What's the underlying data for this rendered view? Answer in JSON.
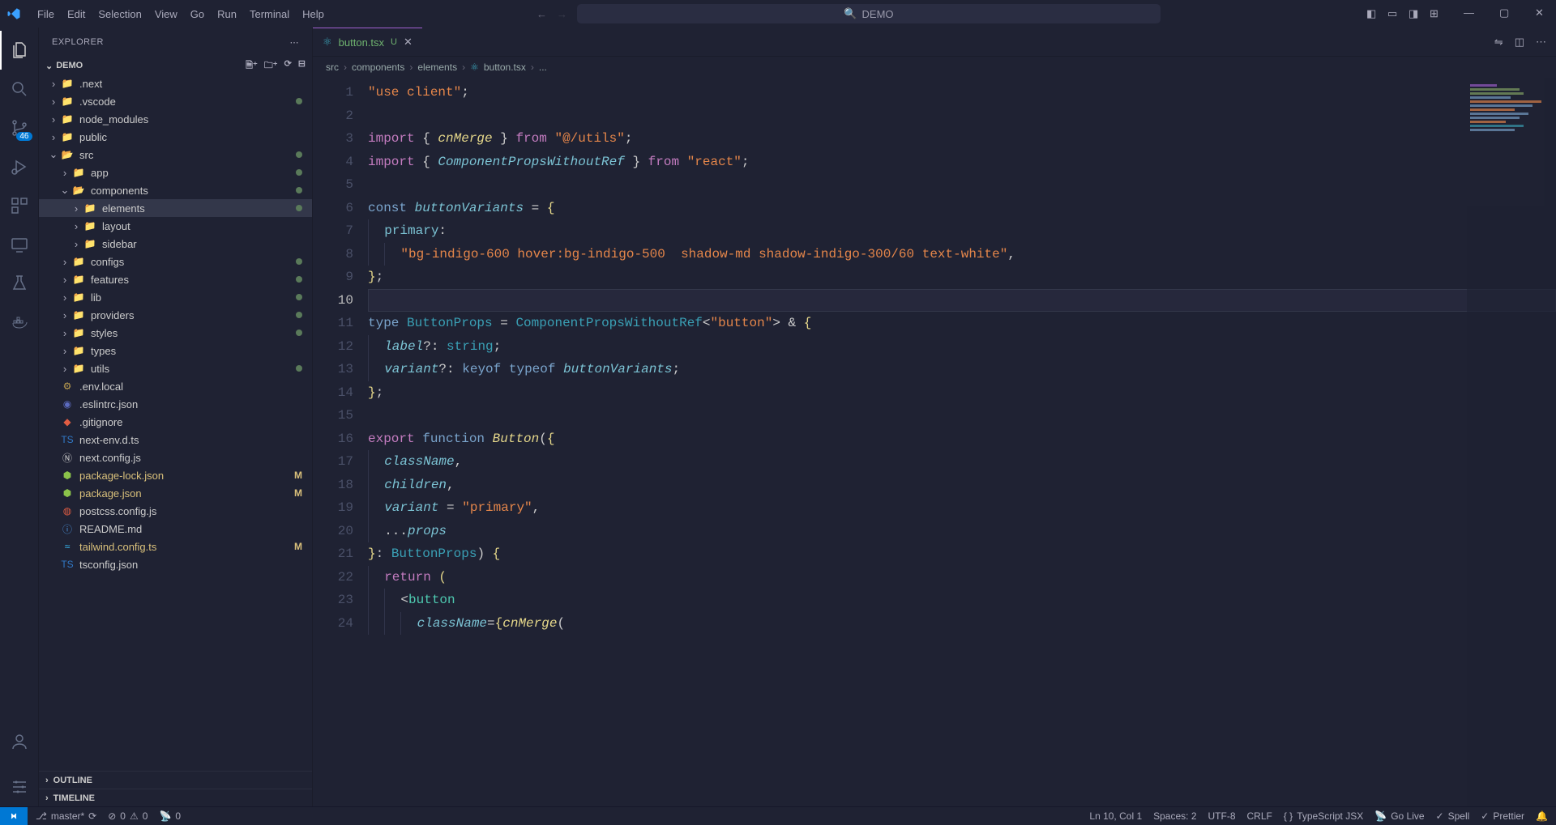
{
  "menu": {
    "items": [
      "File",
      "Edit",
      "Selection",
      "View",
      "Go",
      "Run",
      "Terminal",
      "Help"
    ]
  },
  "search": {
    "placeholder": "DEMO"
  },
  "explorer": {
    "title": "EXPLORER",
    "project": "DEMO"
  },
  "badges": {
    "scm": "46"
  },
  "tree": [
    {
      "depth": 0,
      "kind": "folder",
      "name": ".next",
      "chev": "›",
      "color": "#888",
      "icon": "📁",
      "status": ""
    },
    {
      "depth": 0,
      "kind": "folder",
      "name": ".vscode",
      "chev": "›",
      "color": "#4a90d9",
      "icon": "📁",
      "status": "dot"
    },
    {
      "depth": 0,
      "kind": "folder",
      "name": "node_modules",
      "chev": "›",
      "color": "#8bc34a",
      "icon": "📁",
      "status": ""
    },
    {
      "depth": 0,
      "kind": "folder",
      "name": "public",
      "chev": "›",
      "color": "#4a90d9",
      "icon": "📁",
      "status": ""
    },
    {
      "depth": 0,
      "kind": "folder",
      "name": "src",
      "chev": "⌄",
      "color": "#8bc34a",
      "icon": "📂",
      "status": "dot"
    },
    {
      "depth": 1,
      "kind": "folder",
      "name": "app",
      "chev": "›",
      "color": "#e57373",
      "icon": "📁",
      "status": "dot"
    },
    {
      "depth": 1,
      "kind": "folder",
      "name": "components",
      "chev": "⌄",
      "color": "#c0a050",
      "icon": "📂",
      "status": "dot"
    },
    {
      "depth": 2,
      "kind": "folder",
      "name": "elements",
      "chev": "›",
      "color": "#aaa",
      "icon": "📁",
      "status": "dot",
      "selected": true
    },
    {
      "depth": 2,
      "kind": "folder",
      "name": "layout",
      "chev": "›",
      "color": "#aaa",
      "icon": "📁",
      "status": ""
    },
    {
      "depth": 2,
      "kind": "folder",
      "name": "sidebar",
      "chev": "›",
      "color": "#aaa",
      "icon": "📁",
      "status": ""
    },
    {
      "depth": 1,
      "kind": "folder",
      "name": "configs",
      "chev": "›",
      "color": "#c0a050",
      "icon": "📁",
      "status": "dot"
    },
    {
      "depth": 1,
      "kind": "folder",
      "name": "features",
      "chev": "›",
      "color": "#c0a050",
      "icon": "📁",
      "status": "dot"
    },
    {
      "depth": 1,
      "kind": "folder",
      "name": "lib",
      "chev": "›",
      "color": "#c0a050",
      "icon": "📁",
      "status": "dot"
    },
    {
      "depth": 1,
      "kind": "folder",
      "name": "providers",
      "chev": "›",
      "color": "#c0a050",
      "icon": "📁",
      "status": "dot"
    },
    {
      "depth": 1,
      "kind": "folder",
      "name": "styles",
      "chev": "›",
      "color": "#c0a050",
      "icon": "📁",
      "status": "dot"
    },
    {
      "depth": 1,
      "kind": "folder",
      "name": "types",
      "chev": "›",
      "color": "#3a91c0",
      "icon": "📁",
      "status": ""
    },
    {
      "depth": 1,
      "kind": "folder",
      "name": "utils",
      "chev": "›",
      "color": "#c0a050",
      "icon": "📁",
      "status": "dot"
    },
    {
      "depth": 0,
      "kind": "file",
      "name": ".env.local",
      "icon": "⚙",
      "color": "#c0a050"
    },
    {
      "depth": 0,
      "kind": "file",
      "name": ".eslintrc.json",
      "icon": "◉",
      "color": "#5c6bc0"
    },
    {
      "depth": 0,
      "kind": "file",
      "name": ".gitignore",
      "icon": "◆",
      "color": "#e25d43"
    },
    {
      "depth": 0,
      "kind": "file",
      "name": "next-env.d.ts",
      "icon": "TS",
      "color": "#3178c6"
    },
    {
      "depth": 0,
      "kind": "file",
      "name": "next.config.js",
      "icon": "Ⓝ",
      "color": "#ccc"
    },
    {
      "depth": 0,
      "kind": "file",
      "name": "package-lock.json",
      "icon": "⬢",
      "color": "#8bc34a",
      "git": "M"
    },
    {
      "depth": 0,
      "kind": "file",
      "name": "package.json",
      "icon": "⬢",
      "color": "#8bc34a",
      "git": "M"
    },
    {
      "depth": 0,
      "kind": "file",
      "name": "postcss.config.js",
      "icon": "◍",
      "color": "#e25d43"
    },
    {
      "depth": 0,
      "kind": "file",
      "name": "README.md",
      "icon": "ⓘ",
      "color": "#4a90d9"
    },
    {
      "depth": 0,
      "kind": "file",
      "name": "tailwind.config.ts",
      "icon": "≈",
      "color": "#38bdf8",
      "git": "M"
    },
    {
      "depth": 0,
      "kind": "file",
      "name": "tsconfig.json",
      "icon": "TS",
      "color": "#3178c6"
    }
  ],
  "sidebar_sections": {
    "outline": "OUTLINE",
    "timeline": "TIMELINE"
  },
  "tab": {
    "file": "button.tsx",
    "git_tag": "U"
  },
  "breadcrumb": [
    "src",
    "components",
    "elements",
    "button.tsx",
    "..."
  ],
  "code_lines": [
    [
      [
        "str",
        "\"use client\""
      ],
      [
        "op",
        ";"
      ]
    ],
    [],
    [
      [
        "kw2",
        "import"
      ],
      [
        "op",
        " { "
      ],
      [
        "fn",
        "cnMerge"
      ],
      [
        "op",
        " } "
      ],
      [
        "kw2",
        "from"
      ],
      [
        "op",
        " "
      ],
      [
        "str",
        "\"@/utils\""
      ],
      [
        "op",
        ";"
      ]
    ],
    [
      [
        "kw2",
        "import"
      ],
      [
        "op",
        " { "
      ],
      [
        "var",
        "ComponentPropsWithoutRef"
      ],
      [
        "op",
        " } "
      ],
      [
        "kw2",
        "from"
      ],
      [
        "op",
        " "
      ],
      [
        "str",
        "\"react\""
      ],
      [
        "op",
        ";"
      ]
    ],
    [],
    [
      [
        "kw",
        "const"
      ],
      [
        "op",
        " "
      ],
      [
        "var",
        "buttonVariants"
      ],
      [
        "op",
        " = "
      ],
      [
        "punc",
        "{"
      ]
    ],
    [
      [
        "indent",
        1
      ],
      [
        "prop",
        "primary"
      ],
      [
        "op",
        ":"
      ]
    ],
    [
      [
        "indent",
        2
      ],
      [
        "str",
        "\"bg-indigo-600 hover:bg-indigo-500  shadow-md shadow-indigo-300/60 text-white\""
      ],
      [
        "op",
        ","
      ]
    ],
    [
      [
        "punc",
        "}"
      ],
      [
        "op",
        ";"
      ]
    ],
    [],
    [
      [
        "kw",
        "type"
      ],
      [
        "op",
        " "
      ],
      [
        "type",
        "ButtonProps"
      ],
      [
        "op",
        " = "
      ],
      [
        "type",
        "ComponentPropsWithoutRef"
      ],
      [
        "op",
        "<"
      ],
      [
        "str",
        "\"button\""
      ],
      [
        "op",
        "> "
      ],
      [
        "op",
        "&"
      ],
      [
        "op",
        " "
      ],
      [
        "punc",
        "{"
      ]
    ],
    [
      [
        "indent",
        1
      ],
      [
        "var",
        "label"
      ],
      [
        "op",
        "?"
      ],
      [
        "op",
        ": "
      ],
      [
        "type",
        "string"
      ],
      [
        "op",
        ";"
      ]
    ],
    [
      [
        "indent",
        1
      ],
      [
        "var",
        "variant"
      ],
      [
        "op",
        "?"
      ],
      [
        "op",
        ": "
      ],
      [
        "kw",
        "keyof"
      ],
      [
        "op",
        " "
      ],
      [
        "kw",
        "typeof"
      ],
      [
        "op",
        " "
      ],
      [
        "var",
        "buttonVariants"
      ],
      [
        "op",
        ";"
      ]
    ],
    [
      [
        "punc",
        "}"
      ],
      [
        "op",
        ";"
      ]
    ],
    [],
    [
      [
        "kw2",
        "export"
      ],
      [
        "op",
        " "
      ],
      [
        "kw",
        "function"
      ],
      [
        "op",
        " "
      ],
      [
        "fn",
        "Button"
      ],
      [
        "op",
        "("
      ],
      [
        "punc",
        "{"
      ]
    ],
    [
      [
        "indent",
        1
      ],
      [
        "var",
        "className"
      ],
      [
        "op",
        ","
      ]
    ],
    [
      [
        "indent",
        1
      ],
      [
        "var",
        "children"
      ],
      [
        "op",
        ","
      ]
    ],
    [
      [
        "indent",
        1
      ],
      [
        "var",
        "variant"
      ],
      [
        "op",
        " = "
      ],
      [
        "str",
        "\"primary\""
      ],
      [
        "op",
        ","
      ]
    ],
    [
      [
        "indent",
        1
      ],
      [
        "op",
        "..."
      ],
      [
        "var",
        "props"
      ]
    ],
    [
      [
        "punc",
        "}"
      ],
      [
        "op",
        ": "
      ],
      [
        "type",
        "ButtonProps"
      ],
      [
        "op",
        ") "
      ],
      [
        "punc",
        "{"
      ]
    ],
    [
      [
        "indent",
        1
      ],
      [
        "kw2",
        "return"
      ],
      [
        "op",
        " "
      ],
      [
        "punc",
        "("
      ]
    ],
    [
      [
        "indent",
        2
      ],
      [
        "op",
        "<"
      ],
      [
        "tag",
        "button"
      ]
    ],
    [
      [
        "indent",
        3
      ],
      [
        "var",
        "className"
      ],
      [
        "op",
        "="
      ],
      [
        "punc",
        "{"
      ],
      [
        "fn",
        "cnMerge"
      ],
      [
        "op",
        "("
      ]
    ]
  ],
  "current_line": 10,
  "status": {
    "left": {
      "branch": "master*",
      "sync": "⟳",
      "problems": "0  0",
      "ports": "0",
      "problems_icon_error": "⊘",
      "problems_icon_warn": "⚠",
      "port_icon": "📡"
    },
    "right": {
      "cursor": "Ln 10, Col 1",
      "spaces": "Spaces: 2",
      "encoding": "UTF-8",
      "eol": "CRLF",
      "lang": "TypeScript JSX",
      "golive": "Go Live",
      "spell": "Spell",
      "prettier": "Prettier"
    }
  }
}
